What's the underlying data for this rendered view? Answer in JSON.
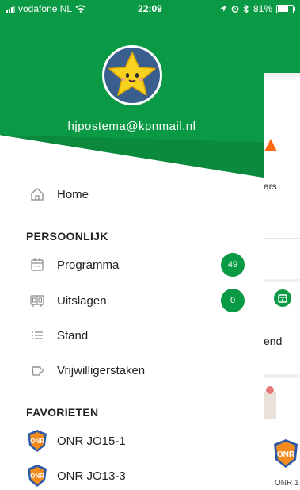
{
  "status_bar": {
    "carrier": "vodafone NL",
    "time": "22:09",
    "battery": "81%",
    "battery_level": 0.81
  },
  "account": {
    "email": "hjpostema@kpnmail.nl"
  },
  "menu": {
    "home_label": "Home",
    "personal_section": "PERSOONLIJK",
    "items": [
      {
        "label": "Programma",
        "icon": "calendar-icon",
        "badge": "49"
      },
      {
        "label": "Uitslagen",
        "icon": "scoreboard-icon",
        "badge": "0"
      },
      {
        "label": "Stand",
        "icon": "list-icon"
      },
      {
        "label": "Vrijwilligerstaken",
        "icon": "cup-icon"
      }
    ],
    "favorites_section": "FAVORIETEN",
    "favorites": [
      {
        "label": "ONR JO15-1",
        "icon": "club-logo-icon"
      },
      {
        "label": "ONR JO13-3",
        "icon": "club-logo-icon"
      }
    ]
  },
  "background": {
    "stars_text": "ars",
    "end_text": "end",
    "logo_text": "ONR 1"
  },
  "colors": {
    "brand_green": "#0a9a45",
    "accent_orange": "#ff6a13"
  }
}
